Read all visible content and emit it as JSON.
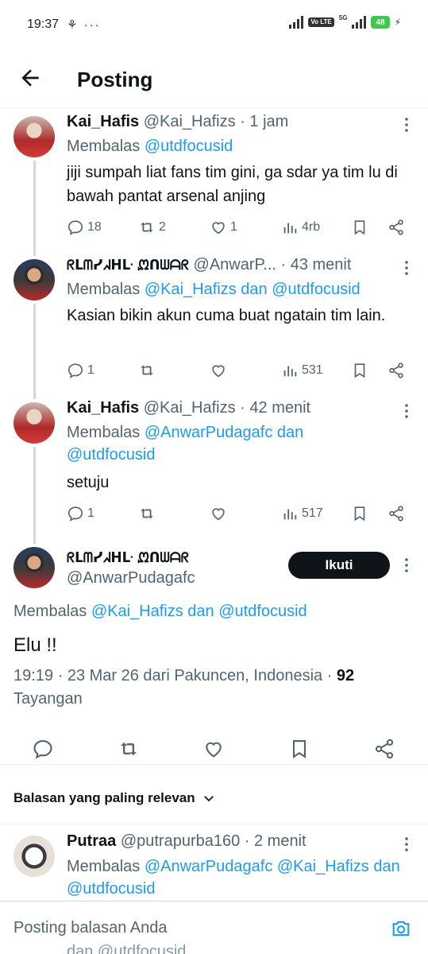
{
  "status_bar": {
    "time": "19:37",
    "left_icons": "⚘ ···",
    "volte": "Vo LTE",
    "net": "5G",
    "battery": "48"
  },
  "header": {
    "title": "Posting"
  },
  "tweets": [
    {
      "name": "Kai_Hafis",
      "handle_time": "@Kai_Hafizs · 1 jam",
      "reply_prefix": "Membalas ",
      "reply_to": "@utdfocusid",
      "text": "jiji sumpah liat fans tim gini, ga sdar ya tim lu di bawah pantat arsenal anjing",
      "replies": "18",
      "reposts": "2",
      "likes": "1",
      "views": "4rb"
    },
    {
      "name": "ᖇᒪᗰᓯᖽᕼᒷ ᘻᑎᗯᗩᖇ",
      "handle_time": "@AnwarP... · 43 menit",
      "reply_prefix": "Membalas ",
      "reply_to": "@Kai_Hafizs dan @utdfocusid",
      "text": "Kasian bikin akun cuma buat ngatain tim lain.",
      "replies": "1",
      "reposts": "",
      "likes": "",
      "views": "531"
    },
    {
      "name": "Kai_Hafis",
      "handle_time": "@Kai_Hafizs · 42 menit",
      "reply_prefix": "Membalas ",
      "reply_to": "@AnwarPudagafc dan @utdfocusid",
      "text": "setuju",
      "replies": "1",
      "reposts": "",
      "likes": "",
      "views": "517"
    }
  ],
  "main_tweet": {
    "name": "ᖇᒪᗰᓯᖽᕼᒷ ᘻᑎᗯᗩᖇ",
    "handle": "@AnwarPudagafc",
    "follow_label": "Ikuti",
    "reply_prefix": "Membalas ",
    "reply_to": "@Kai_Hafizs dan @utdfocusid",
    "text": "Elu !!",
    "meta": "19:19 · 23 Mar 26 dari Pakuncen, Indonesia · ",
    "views_count": "92",
    "views_label": "Tayangan"
  },
  "sort_label": "Balasan yang paling relevan",
  "reply_tweet": {
    "name": "Putraa",
    "handle_time": "@putrapurba160 · 2 menit",
    "reply_prefix": "Membalas ",
    "reply_to": "@AnwarPudagafc @Kai_Hafizs dan @utdfocusid"
  },
  "composer": {
    "placeholder": "Posting balasan Anda",
    "ghost_text": "dan @utdfocusid"
  },
  "colors": {
    "accent": "#1d9bf0",
    "text": "#0f1419",
    "muted": "#536471",
    "battery": "#3cc84b"
  }
}
